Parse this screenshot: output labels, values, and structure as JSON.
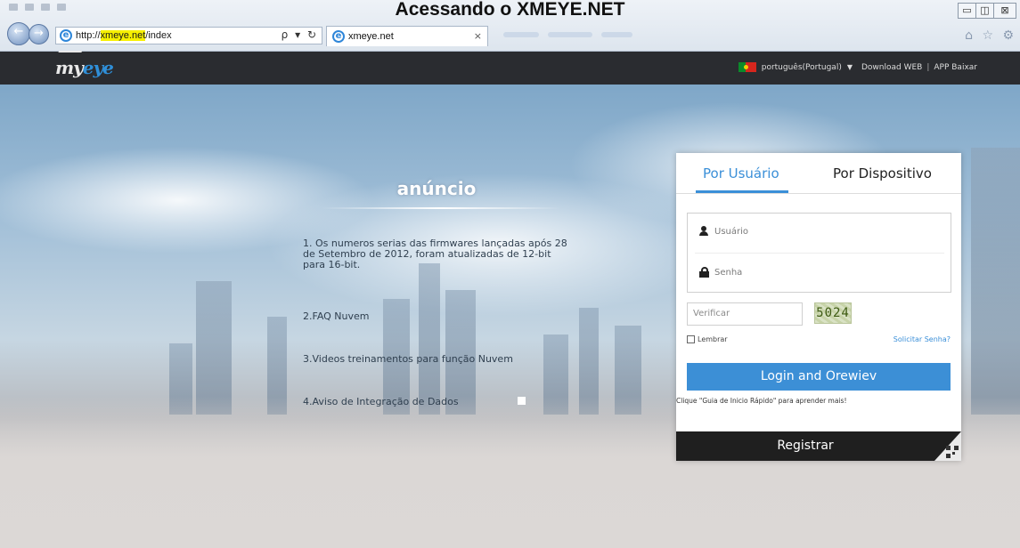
{
  "slide": {
    "title": "Acessando o XMEYE.NET"
  },
  "browser": {
    "url_prefix": "http://",
    "url_domain": "xmeye.net",
    "url_path": "/index",
    "tab_title": "xmeye.net",
    "tab_close": "×",
    "addr_tools": "ρ ▾ ↻",
    "window_controls": [
      "▭",
      "◫",
      "⊠"
    ],
    "toolbar_icons": "⌂ ☆ ⚙"
  },
  "header": {
    "logo_text_main": "my",
    "logo_text_accent": "eye",
    "language": "português(Portugal)",
    "caret": "▼",
    "download_web": "Download WEB",
    "separator": "|",
    "app_download": "APP Baixar",
    "colors": {
      "bar": "#2a2c30",
      "accent": "#2f8fd8"
    }
  },
  "announcement": {
    "title": "anúncio",
    "items": [
      "1. Os numeros serias das firmwares lançadas após 28 de Setembro de 2012, foram atualizadas de 12-bit para 16-bit.",
      "2.FAQ Nuvem",
      "3.Videos treinamentos para função Nuvem",
      "4.Aviso de Integração de Dados"
    ]
  },
  "login": {
    "tab_user": "Por Usuário",
    "tab_device": "Por Dispositivo",
    "username_placeholder": "Usuário",
    "password_placeholder": "Senha",
    "verify_placeholder": "Verificar",
    "captcha": "5024",
    "remember_label": "Lembrar",
    "forgot_password": "Solicitar Senha?",
    "login_button": "Login and Orewiev",
    "hint": "Clique \"Guia de Inicio Rápido\" para aprender mais!",
    "register_button": "Registrar",
    "colors": {
      "primary": "#3c8fd6",
      "dark": "#1f1f1f"
    }
  }
}
